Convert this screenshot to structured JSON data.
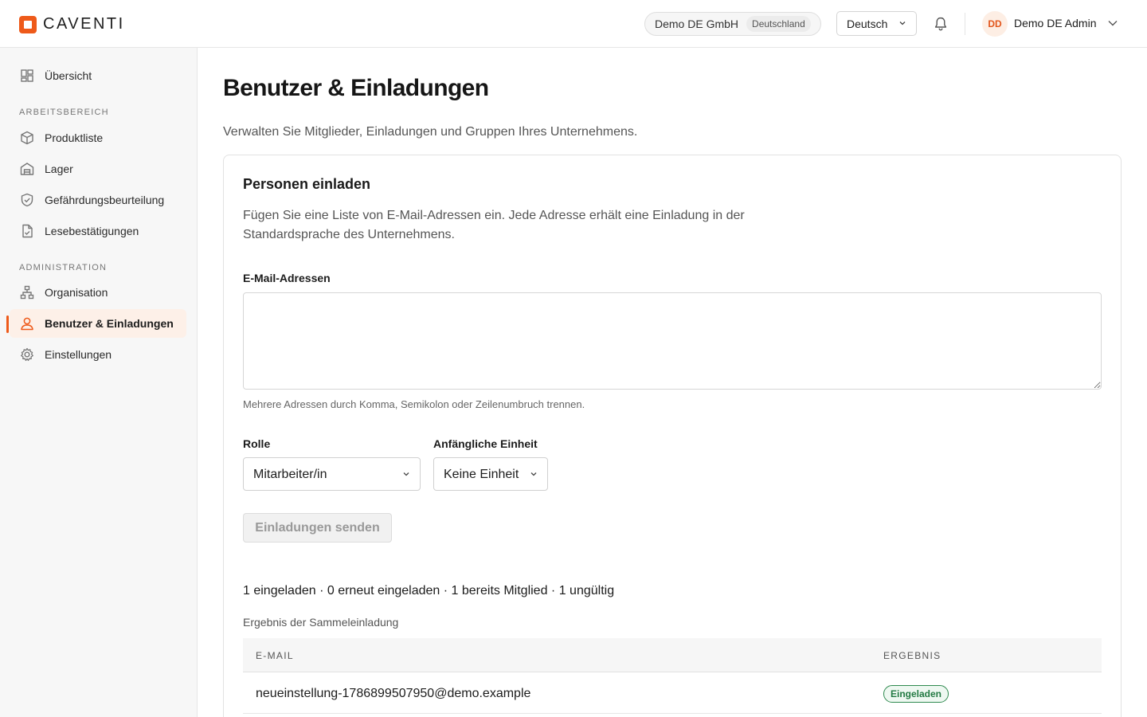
{
  "brand": {
    "name": "CAVENTI",
    "accent": "#ee5a1a"
  },
  "header": {
    "company": "Demo DE GmbH",
    "country": "Deutschland",
    "language": "Deutsch",
    "avatar_initials": "DD",
    "user_name": "Demo DE Admin"
  },
  "sidebar": {
    "overview": "Übersicht",
    "sections": [
      {
        "title": "ARBEITSBEREICH",
        "items": [
          "Produktliste",
          "Lager",
          "Gefährdungsbeurteilung",
          "Lesebestätigungen"
        ]
      },
      {
        "title": "ADMINISTRATION",
        "items": [
          "Organisation",
          "Benutzer & Einladungen",
          "Einstellungen"
        ]
      }
    ],
    "active_item": "Benutzer & Einladungen"
  },
  "page": {
    "title": "Benutzer & Einladungen",
    "subtitle": "Verwalten Sie Mitglieder, Einladungen und Gruppen Ihres Unternehmens."
  },
  "invite": {
    "title": "Personen einladen",
    "description": "Fügen Sie eine Liste von E-Mail-Adressen ein. Jede Adresse erhält eine Einladung in der Standardsprache des Unternehmens.",
    "emails_label": "E-Mail-Adressen",
    "emails_value": "",
    "hint": "Mehrere Adressen durch Komma, Semikolon oder Zeilenumbruch trennen.",
    "role_label": "Rolle",
    "role_value": "Mitarbeiter/in",
    "unit_label": "Anfängliche Einheit",
    "unit_value": "Keine Einheit",
    "send_label": "Einladungen senden"
  },
  "result": {
    "summary": "1 eingeladen · 0 erneut eingeladen · 1 bereits Mitglied · 1 ungültig",
    "caption": "Ergebnis der Sammeleinladung",
    "columns": [
      "E-MAIL",
      "ERGEBNIS"
    ],
    "rows": [
      {
        "email": "neueinstellung-1786899507950@demo.example",
        "status": "Eingeladen",
        "status_color": "#237a43"
      }
    ]
  }
}
